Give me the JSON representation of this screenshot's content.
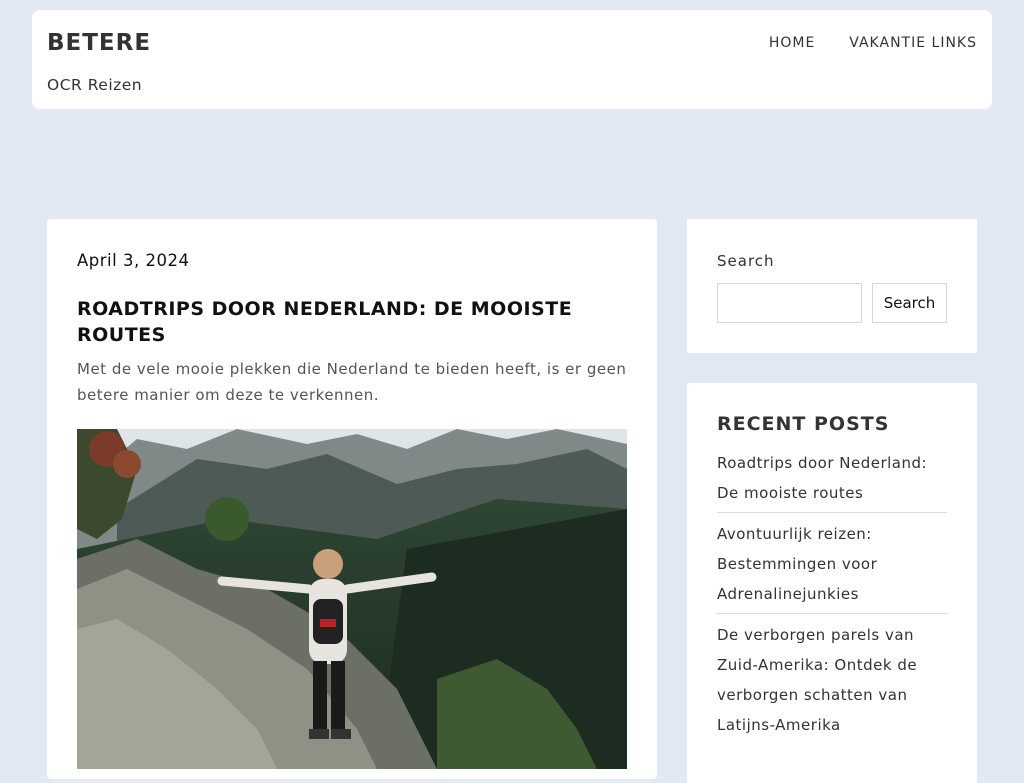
{
  "site": {
    "title": "BETERE",
    "tagline": "OCR Reizen"
  },
  "nav": {
    "items": [
      "HOME",
      "VAKANTIE LINKS"
    ]
  },
  "post": {
    "date": "April 3, 2024",
    "title": "ROADTRIPS DOOR NEDERLAND: DE MOOISTE ROUTES",
    "excerpt": "Met de vele mooie plekken die Nederland te bieden heeft, is er geen betere manier om deze te verkennen."
  },
  "search": {
    "label": "Search",
    "value": "",
    "placeholder": "",
    "button_label": "Search"
  },
  "recent_posts": {
    "title": "RECENT POSTS",
    "items": [
      "Roadtrips door Nederland: De mooiste routes",
      "Avontuurlijk reizen: Bestemmingen voor Adrenalinejunkies",
      "De verborgen parels van Zuid-Amerika: Ontdek de verborgen schatten van Latijns-Amerika"
    ]
  },
  "colors": {
    "page_background": "#e3e9f4",
    "card_background": "#ffffff",
    "text_primary": "#111111",
    "text_secondary": "#555555"
  }
}
